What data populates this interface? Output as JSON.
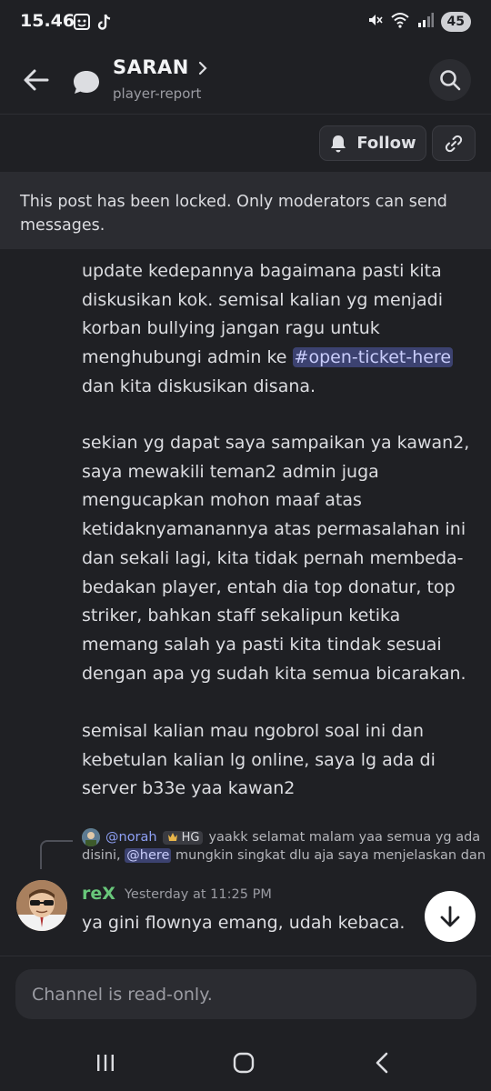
{
  "status_bar": {
    "time": "15.46",
    "battery": "45",
    "left_icons": [
      "screenshot-icon",
      "tiktok-icon"
    ],
    "right_icons": [
      "mute-icon",
      "wifi-icon",
      "signal-icon"
    ]
  },
  "header": {
    "channel_name": "SARAN",
    "channel_subtitle": "player-report"
  },
  "actions": {
    "follow_label": "Follow"
  },
  "locked_banner": {
    "text": "This post has been locked. Only moderators can send messages."
  },
  "message1": {
    "part1": "update kedepannya bagaimana pasti kita diskusikan kok. semisal kalian yg menjadi korban bullying jangan ragu untuk menghubungi admin ke ",
    "channel_mention": "#open-ticket-here",
    "part2": " dan kita diskusikan disana.",
    "paragraph2": "sekian yg dapat saya sampaikan ya kawan2, saya mewakili teman2 admin juga mengucapkan mohon maaf atas ketidaknyamanannya atas permasalahan ini dan sekali lagi, kita tidak pernah membeda-bedakan player, entah dia top donatur, top striker, bahkan staff sekalipun ketika memang salah ya pasti kita tindak sesuai dengan apa yg sudah kita semua bicarakan.",
    "paragraph3": "semisal kalian mau ngobrol soal ini dan kebetulan kalian lg online, saya lg ada di server b33e yaa kawan2"
  },
  "reply_preview": {
    "author": "@norah",
    "badge": "HG",
    "text_line1": "yaakk selamat malam yaa semua yg ada",
    "text_line2_prefix": "disini, ",
    "mention": "@here",
    "text_line2_suffix": " mungkin singkat dlu aja saya menjelaskan dan"
  },
  "message2": {
    "author": "reX",
    "timestamp": "Yesterday at 11:25 PM",
    "text": "ya gini flownya emang, udah kebaca."
  },
  "composer": {
    "placeholder": "Channel is read-only."
  },
  "colors": {
    "background": "#1f2024",
    "author_green": "#68c77a",
    "mention_bg": "#3c4270",
    "mention_fg": "#c9cdfb"
  }
}
